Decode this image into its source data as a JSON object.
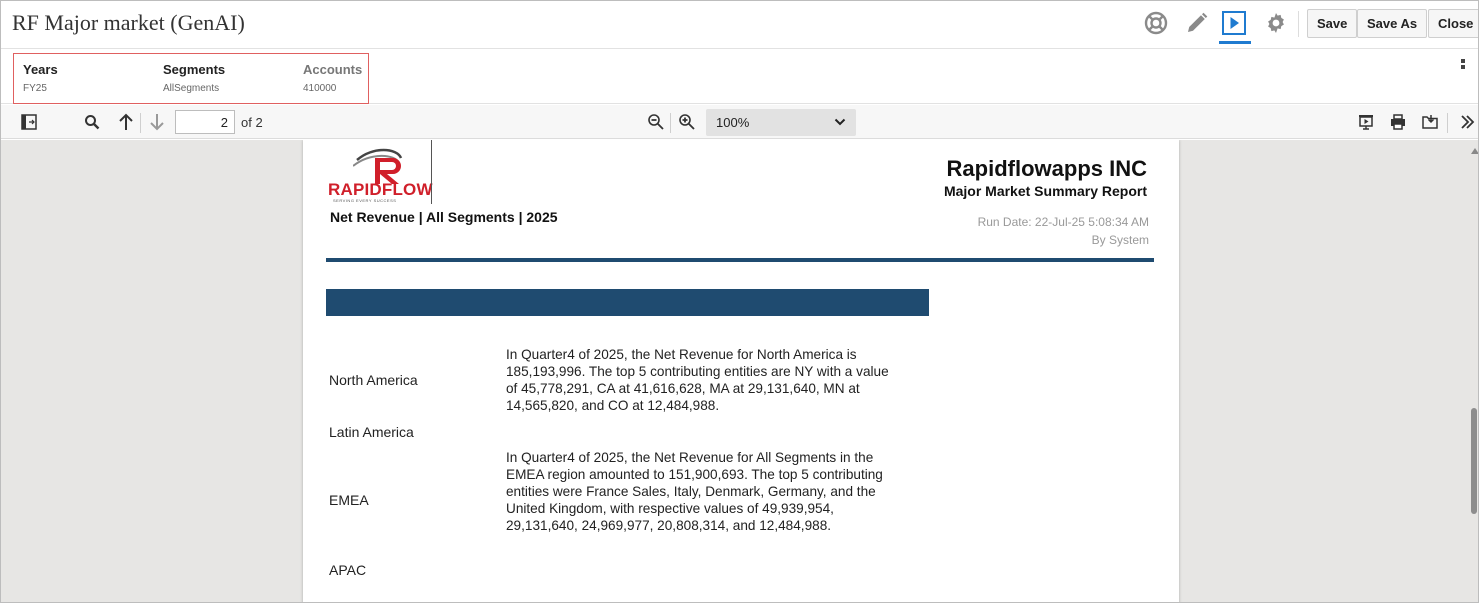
{
  "header": {
    "title": "RF Major market (GenAI)",
    "buttons": {
      "save": "Save",
      "save_as": "Save As",
      "close": "Close"
    },
    "icons": [
      "help-lifebuoy-icon",
      "pencil-icon",
      "play-icon",
      "gear-icon"
    ]
  },
  "pov": {
    "items": [
      {
        "label": "Years",
        "value": "FY25"
      },
      {
        "label": "Segments",
        "value": "AllSegments"
      },
      {
        "label": "Accounts",
        "value": "410000"
      }
    ]
  },
  "toolbar": {
    "page_current": "2",
    "page_total": "of 2",
    "zoom": "100%"
  },
  "report": {
    "logo_text": "RAPIDFLOW",
    "logo_tagline": "SERVING EVERY SUCCESS",
    "subtitle": "Net Revenue | All Segments | 2025",
    "company": "Rapidflowapps INC",
    "title": "Major Market Summary Report",
    "run_date": "Run Date: 22-Jul-25 5:08:34 AM",
    "run_by": "By System",
    "rows": [
      {
        "region": "North America",
        "narrative": "In Quarter4 of 2025, the Net Revenue for North America is 185,193,996. The top 5 contributing entities are NY with a value of 45,778,291, CA at 41,616,628, MA at 29,131,640, MN at 14,565,820, and CO at 12,484,988."
      },
      {
        "region": "Latin America",
        "narrative": ""
      },
      {
        "region": "EMEA",
        "narrative": "In Quarter4 of 2025, the Net Revenue for All Segments in the EMEA region amounted to 151,900,693. The top 5 contributing entities were France Sales, Italy, Denmark, Germany, and the United Kingdom, with respective values of 49,939,954, 29,131,640, 24,969,977, 20,808,314, and 12,484,988."
      },
      {
        "region": "APAC",
        "narrative": ""
      }
    ]
  },
  "colors": {
    "accent": "#1f7bd0",
    "band": "#1f4b70",
    "brand_red": "#d01f2a",
    "pov_border": "#e06060"
  }
}
